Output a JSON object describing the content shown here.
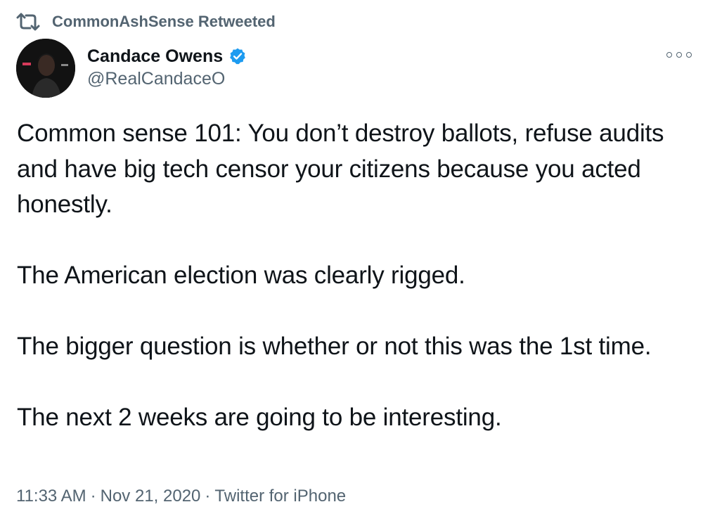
{
  "retweet": {
    "icon": "retweet-icon",
    "label": "CommonAshSense Retweeted"
  },
  "author": {
    "name": "Candace Owens",
    "handle": "@RealCandaceO",
    "verified_icon": "verified-badge-icon",
    "avatar": "avatar"
  },
  "more_icon": "more-options-icon",
  "tweet": {
    "paragraphs": [
      "Common sense 101: You don’t destroy ballots, refuse audits and have big tech censor your citizens because you acted honestly.",
      "The American election was clearly rigged.",
      "The bigger question is whether or not this was the 1st time.",
      "The next 2 weeks are going to be interesting."
    ]
  },
  "meta": {
    "time": "11:33 AM",
    "separator": "·",
    "date": "Nov 21, 2020",
    "source": "Twitter for iPhone"
  },
  "colors": {
    "text": "#0f1419",
    "secondary": "#536471",
    "verified": "#1d9bf0"
  }
}
